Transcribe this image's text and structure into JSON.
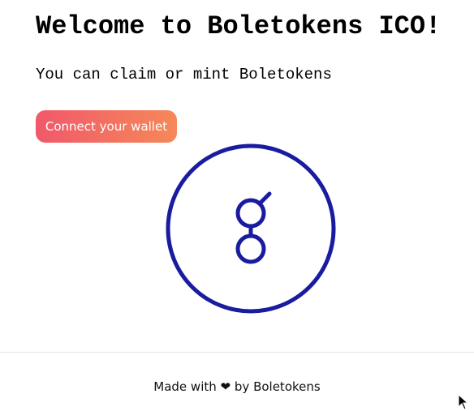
{
  "hero": {
    "title": "Welcome to Boletokens ICO!",
    "subtitle": "You can claim or mint Boletokens"
  },
  "actions": {
    "connect_label": "Connect your wallet"
  },
  "logo": {
    "icon": "boletokens-logo-icon",
    "color": "#1a1ca0"
  },
  "footer": {
    "prefix": "Made with",
    "heart": "❤",
    "suffix": "by Boletokens"
  },
  "colors": {
    "button_gradient_start": "#f0596a",
    "button_gradient_end": "#f68859"
  }
}
